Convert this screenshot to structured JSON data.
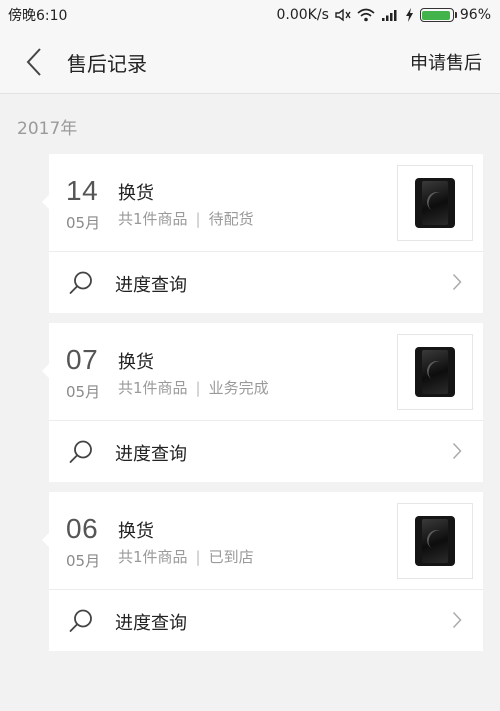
{
  "status_bar": {
    "time": "傍晚6:10",
    "network_speed": "0.00K/s",
    "battery_percent": "96%",
    "battery_level": 0.96,
    "icons": [
      "mute-icon",
      "wifi-icon",
      "signal-icon",
      "charging-icon",
      "battery-icon"
    ]
  },
  "header": {
    "title": "售后记录",
    "action": "申请售后",
    "back_icon": "chevron-left-icon"
  },
  "year_label": "2017年",
  "records": [
    {
      "day": "14",
      "month": "05月",
      "type": "换货",
      "count": "共1件商品",
      "status": "待配货",
      "progress_label": "进度查询"
    },
    {
      "day": "07",
      "month": "05月",
      "type": "换货",
      "count": "共1件商品",
      "status": "业务完成",
      "progress_label": "进度查询"
    },
    {
      "day": "06",
      "month": "05月",
      "type": "换货",
      "count": "共1件商品",
      "status": "已到店",
      "progress_label": "进度查询"
    }
  ],
  "colors": {
    "background": "#f2f2f2",
    "card": "#ffffff",
    "battery_fill": "#41b34a"
  }
}
